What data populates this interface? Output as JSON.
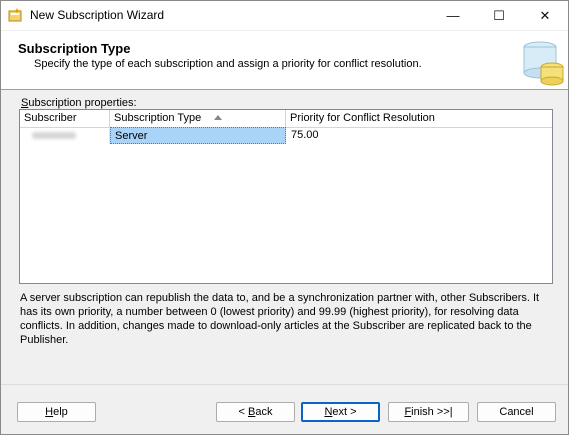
{
  "window": {
    "title": "New Subscription Wizard",
    "minimize_glyph": "—",
    "maximize_glyph": "☐",
    "close_glyph": "✕"
  },
  "banner": {
    "title": "Subscription Type",
    "subtitle": "Specify the type of each subscription and assign a priority for conflict resolution."
  },
  "grid": {
    "label_prefix": "",
    "label_accel": "S",
    "label_rest": "ubscription properties:",
    "columns": [
      "Subscriber",
      "Subscription Type",
      "Priority for Conflict Resolution"
    ],
    "sorted_column": "Subscription Type",
    "rows": [
      {
        "subscriber": "",
        "type": "Server",
        "priority": "75.00"
      }
    ]
  },
  "description": "A server subscription can republish the data to, and be a synchronization partner with, other Subscribers. It has its own priority, a number between 0 (lowest priority) and 99.99 (highest priority), for resolving data conflicts. In addition, changes made to download-only articles at the Subscriber are replicated back to the Publisher.",
  "buttons": {
    "help": {
      "accel": "H",
      "rest": "elp"
    },
    "back": {
      "pre": "< ",
      "accel": "B",
      "rest": "ack"
    },
    "next": {
      "accel": "N",
      "rest": "ext >"
    },
    "finish": {
      "accel": "F",
      "rest": "inish >>|"
    },
    "cancel": {
      "label": "Cancel"
    }
  },
  "colors": {
    "selected_cell": "#a9d3f7",
    "default_button_border": "#0a64c8"
  }
}
